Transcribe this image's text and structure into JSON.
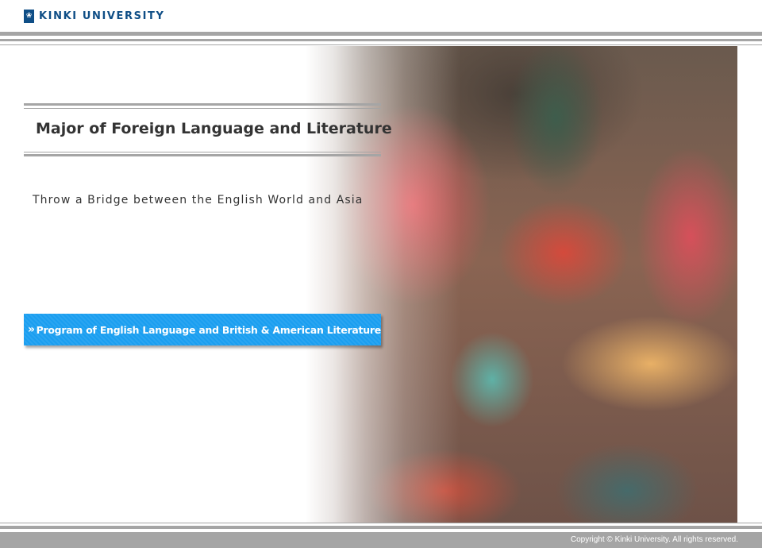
{
  "header": {
    "logo_icon": "university-crest-icon",
    "logo_text": "KINKI UNIVERSITY"
  },
  "hero": {
    "major_title": "Major of Foreign Language and Literature",
    "tagline": "Throw a Bridge between the English World and Asia",
    "program_button_icon": "double-chevron-right-icon",
    "program_button_label": "Program of English Language and  British & American Literature"
  },
  "footer": {
    "copyright": "Copyright © Kinki University. All rights reserved."
  },
  "colors": {
    "brand": "#0f4e86",
    "button": "#1a9ef0",
    "rule": "#a5a5a5",
    "text": "#333333"
  }
}
